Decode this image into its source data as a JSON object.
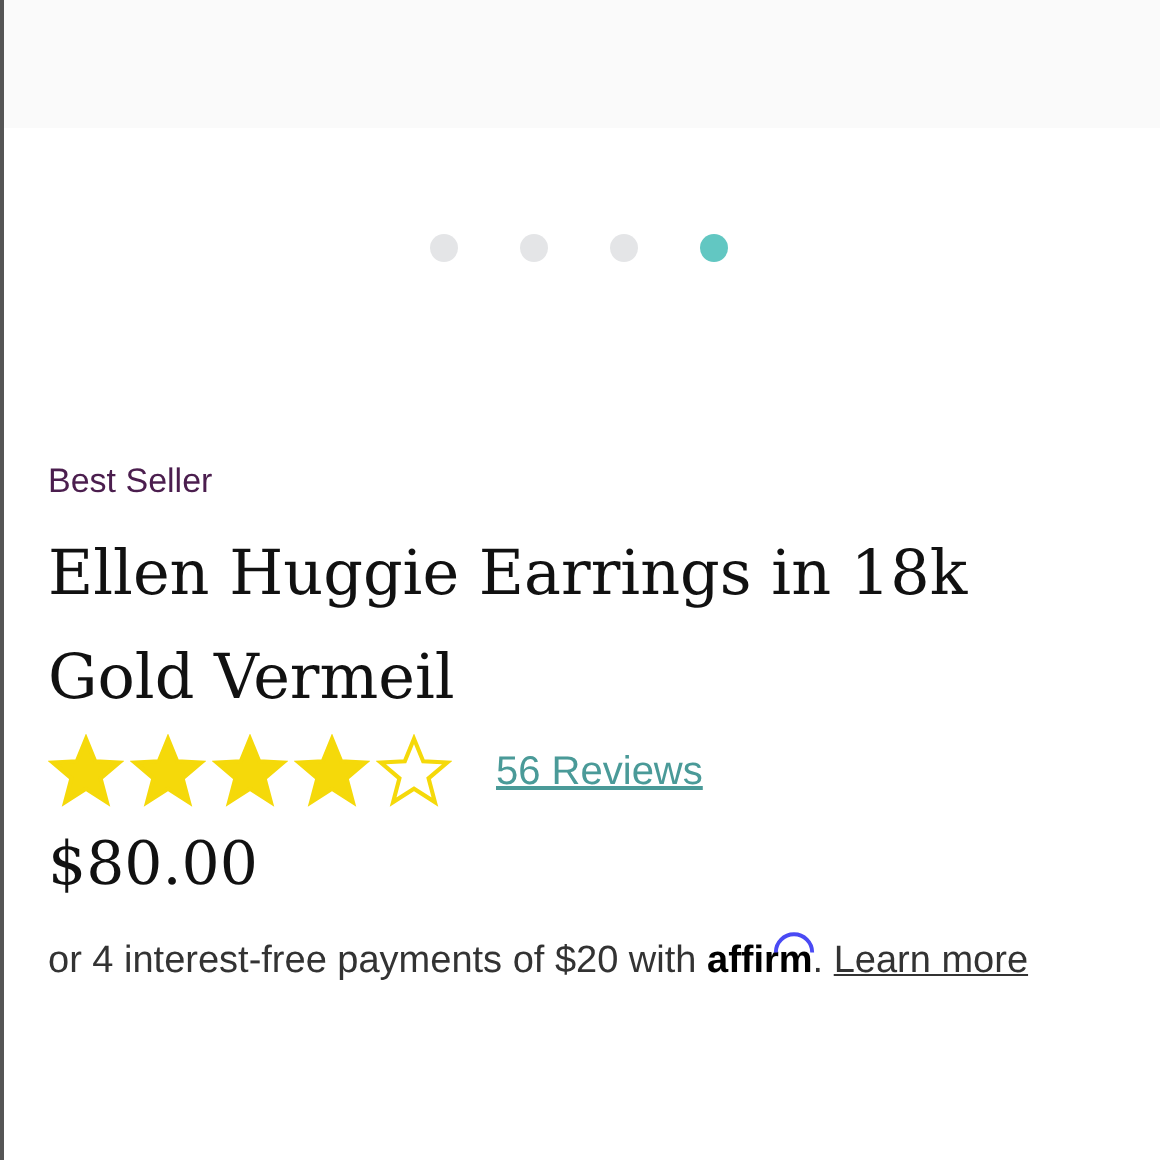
{
  "carousel": {
    "dots": [
      {
        "selected": false
      },
      {
        "selected": false
      },
      {
        "selected": false
      },
      {
        "selected": true
      }
    ]
  },
  "badge": "Best Seller",
  "title": "Ellen Huggie Earrings in 18k Gold Vermeil",
  "rating": {
    "stars": 4,
    "reviews": "56 Reviews"
  },
  "price": "$80.00",
  "financing": {
    "text": "or 4 interest-free payments of $20 with",
    "logo": "affirm",
    "after": ".",
    "link": "Learn more"
  }
}
